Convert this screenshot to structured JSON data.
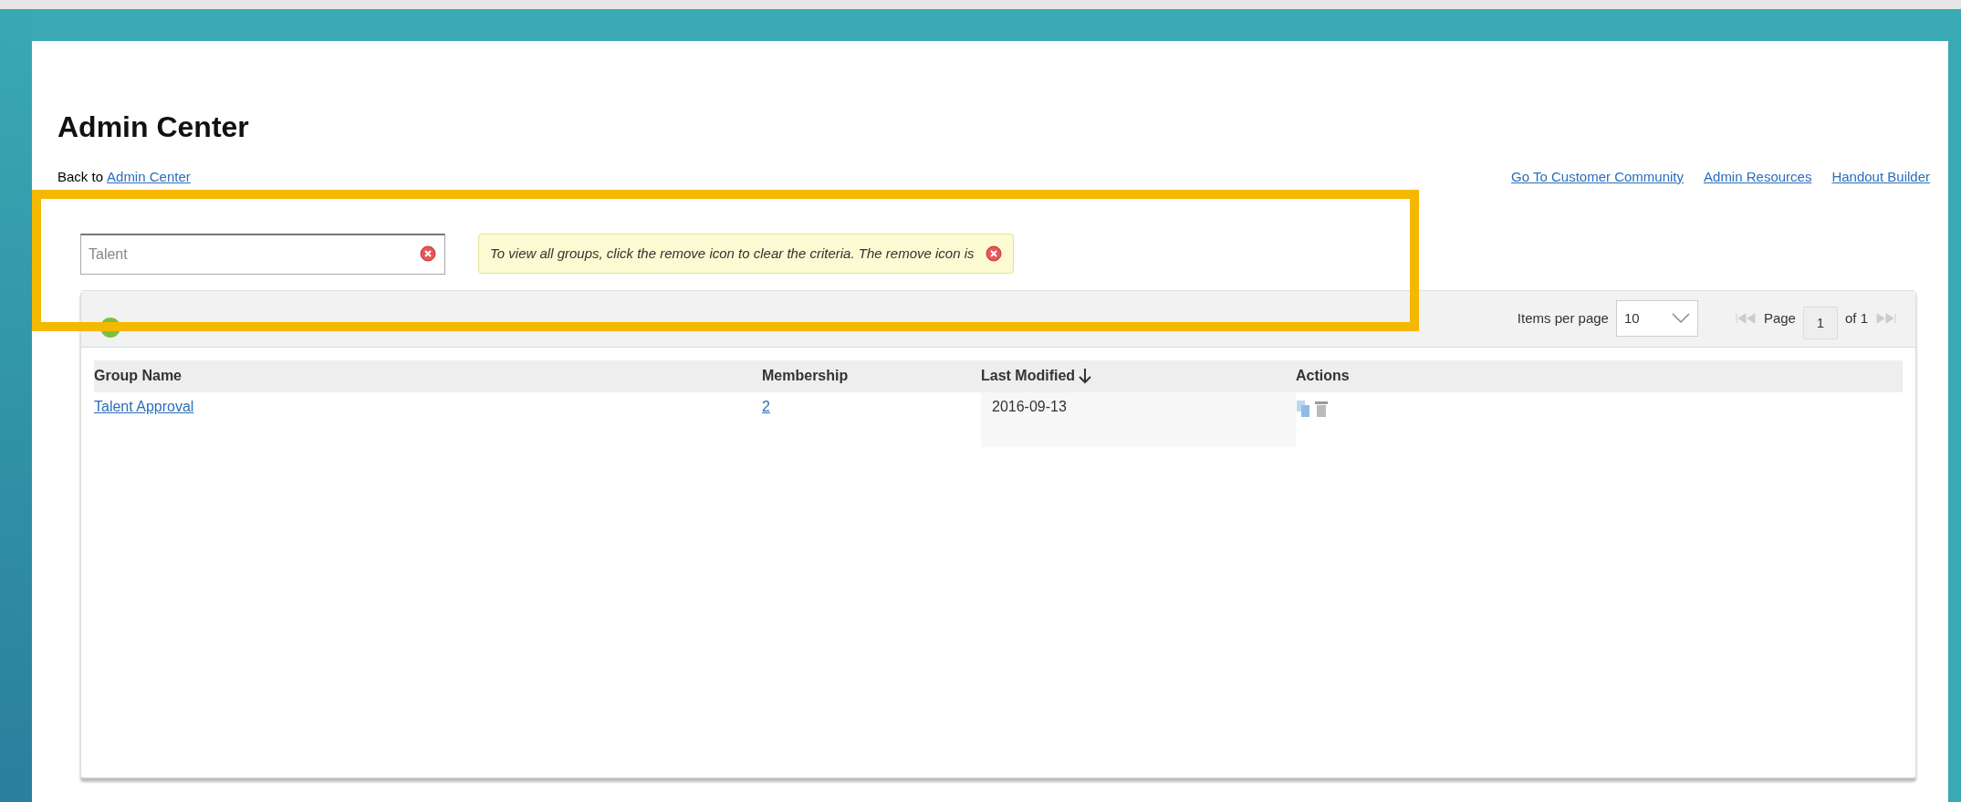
{
  "page_title": "Admin Center",
  "back_link": {
    "label": "Back to",
    "link": "Admin Center"
  },
  "top_links": [
    "Go To Customer Community",
    "Admin Resources",
    "Handout Builder"
  ],
  "search": {
    "value": "Talent"
  },
  "tip": {
    "text": "To view all groups, click the remove icon to clear the criteria. The remove icon is"
  },
  "pagination": {
    "items_label": "Items per page",
    "items_value": "10",
    "page_label": "Page",
    "page": "1",
    "of_label": "of 1"
  },
  "table": {
    "columns": [
      "Group Name",
      "Membership",
      "Last Modified",
      "Actions"
    ],
    "rows": [
      {
        "group_name": "Talent Approval",
        "membership": "2",
        "last_modified": "2016-09-13"
      }
    ]
  }
}
